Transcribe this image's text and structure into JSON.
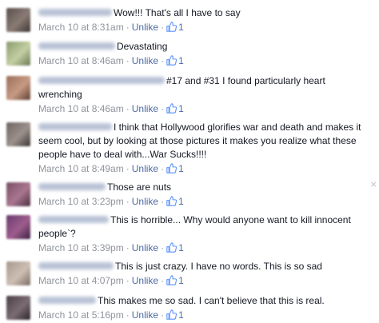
{
  "comments": [
    {
      "text": "Wow!!! That's all I have to say",
      "time": "March 10 at 8:31am",
      "action": "Unlike",
      "likes": "1",
      "avatar_colors": [
        "#5a4f4c",
        "#8a7b74",
        "#3d3533"
      ]
    },
    {
      "text": "Devastating",
      "time": "March 10 at 8:46am",
      "action": "Unlike",
      "likes": "1",
      "avatar_colors": [
        "#8a9a6e",
        "#c3cfa3",
        "#6b7a55"
      ]
    },
    {
      "text": "#17 and #31 I found particularly heart wrenching",
      "time": "March 10 at 8:46am",
      "action": "Unlike",
      "likes": "1",
      "avatar_colors": [
        "#9b6e5a",
        "#c79a83",
        "#5e3f33"
      ]
    },
    {
      "text": "I think that Hollywood glorifies war and death and makes it seem cool, but by looking at those pictures it makes you realize what these people have to deal with...War Sucks!!!!",
      "time": "March 10 at 8:49am",
      "action": "Unlike",
      "likes": "1",
      "avatar_colors": [
        "#6d6460",
        "#9c918c",
        "#3b3533"
      ]
    },
    {
      "text": "Those are nuts",
      "time": "March 10 at 3:23pm",
      "action": "Unlike",
      "likes": "1",
      "avatar_colors": [
        "#7a4f66",
        "#a9768f",
        "#4a2e3e"
      ]
    },
    {
      "text": "This is horrible... Why would anyone want to kill innocent people`?",
      "time": "March 10 at 3:39pm",
      "action": "Unlike",
      "likes": "1",
      "avatar_colors": [
        "#6a3b6e",
        "#9e5d8c",
        "#3a1f44"
      ]
    },
    {
      "text": "This is just crazy. I have no words. This is so sad",
      "time": "March 10 at 4:07pm",
      "action": "Unlike",
      "likes": "1",
      "avatar_colors": [
        "#a7978c",
        "#cdbfb4",
        "#7a6c63"
      ]
    },
    {
      "text": "This makes me so sad. I can't believe that this is real.",
      "time": "March 10 at 5:16pm",
      "action": "Unlike",
      "likes": "1",
      "avatar_colors": [
        "#4a3f45",
        "#7a6c72",
        "#2a2428"
      ]
    }
  ],
  "close_symbol": "×",
  "colors": {
    "link": "#4e69a2",
    "meta": "#90949c",
    "text": "#141823",
    "like_icon": "#5890ff"
  },
  "icons": {
    "like": "thumbs-up-icon",
    "close": "close-icon"
  }
}
